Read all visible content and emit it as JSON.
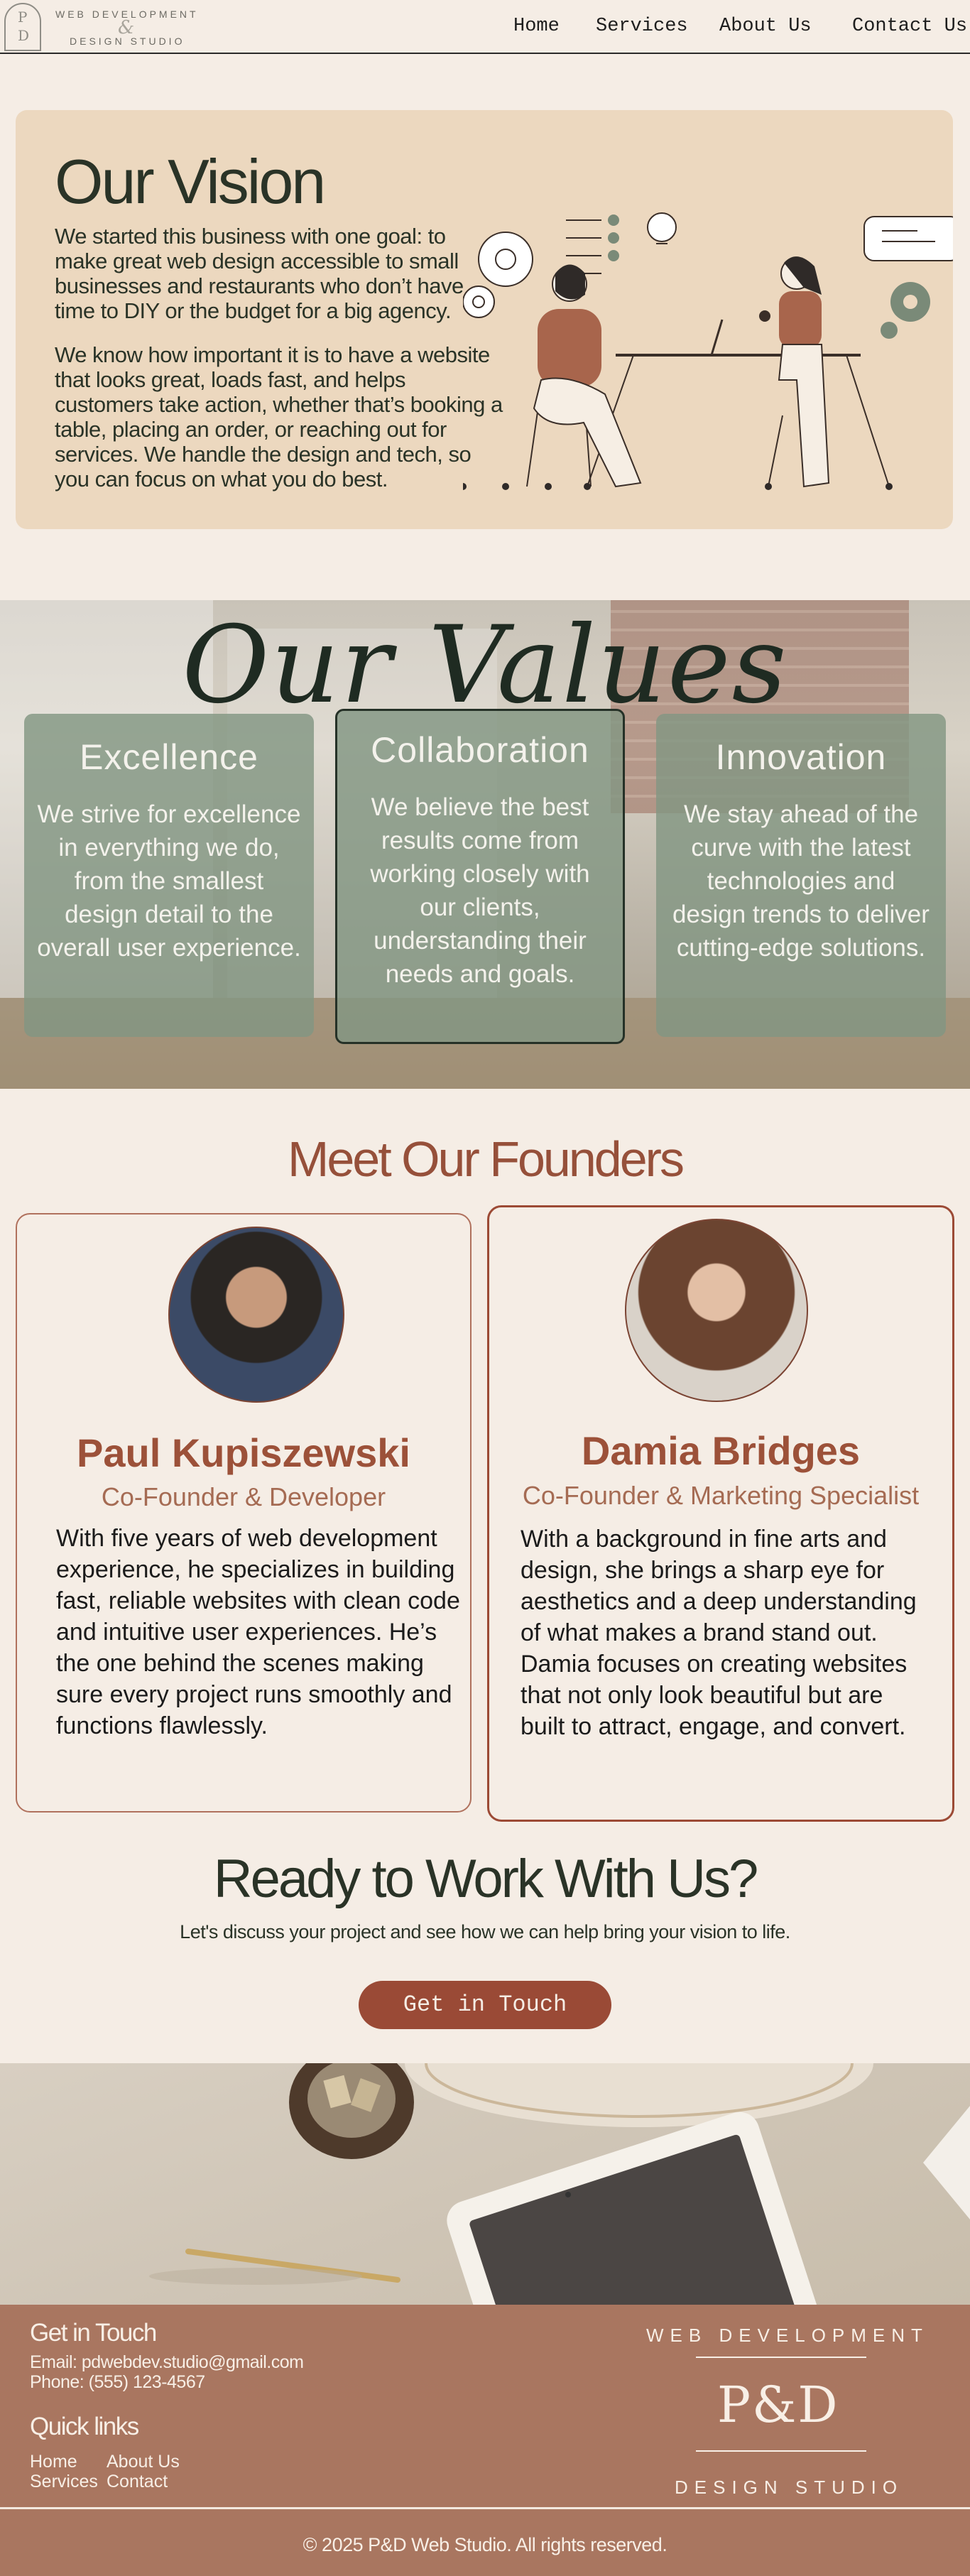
{
  "logo": {
    "top": "WEB DEVELOPMENT",
    "amp": "&",
    "bottom": "DESIGN STUDIO",
    "p": "P",
    "d": "D"
  },
  "nav": {
    "home": "Home",
    "services": "Services",
    "about": "About Us",
    "contact": "Contact Us"
  },
  "vision": {
    "title": "Our Vision",
    "p1": "We started this business with one goal: to make great web design accessible to small businesses and restaurants who don’t have time to DIY or the budget for a big agency.",
    "p2": "We know how important it is to have a website that looks great, loads fast, and helps customers take action, whether that’s booking a table, placing an order, or reaching out for services. We handle the design and tech, so you can focus on what you do best."
  },
  "values": {
    "title": "Our Values",
    "cards": [
      {
        "title": "Excellence",
        "text": "We strive for excellence in everything we do, from the smallest design detail to the overall user experience."
      },
      {
        "title": "Collaboration",
        "text": "We believe the best results come from working closely with our clients, understanding their needs and goals."
      },
      {
        "title": "Innovation",
        "text": "We stay ahead of the curve with the latest technologies and design trends to deliver cutting-edge solutions."
      }
    ]
  },
  "founders": {
    "title": "Meet Our Founders",
    "people": [
      {
        "name": "Paul Kupiszewski",
        "role": "Co-Founder & Developer",
        "bio": "With five years of web development experience, he specializes in building fast, reliable websites with clean code and intuitive user experiences. He’s the one behind the scenes making sure every project runs smoothly and functions flawlessly."
      },
      {
        "name": "Damia Bridges",
        "role": "Co-Founder & Marketing Specialist",
        "bio": "With a background in fine arts and design, she brings a sharp eye for aesthetics and a deep understanding of what makes a brand stand out. Damia focuses on creating websites that not only look beautiful but are built to attract, engage, and convert."
      }
    ]
  },
  "cta": {
    "title": "Ready to Work With Us?",
    "subtitle": "Let's discuss your project and see how we can help bring your vision to life.",
    "button": "Get in Touch"
  },
  "footer": {
    "contact_title": "Get in Touch",
    "email": "Email: pdwebdev.studio@gmail.com",
    "phone": "Phone: (555) 123-4567",
    "links_title": "Quick links",
    "links": {
      "home": "Home",
      "services": "Services",
      "about": "About Us",
      "contact": "Contact"
    },
    "logo_top": "WEB DEVELOPMENT",
    "logo_mark": "P&D",
    "logo_bottom": "DESIGN STUDIO",
    "copyright": "© 2025 P&D Web Studio. All rights reserved."
  },
  "colors": {
    "background": "#f5ede5",
    "accent": "#9a4a36",
    "vision_bg": "#ecd8bf",
    "footer_bg": "#a97660",
    "value_card": "#839682"
  }
}
